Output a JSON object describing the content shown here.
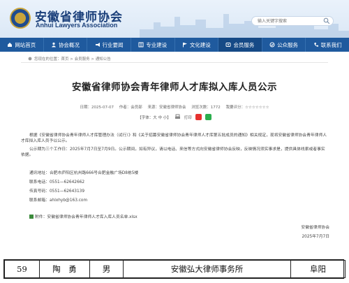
{
  "header": {
    "title": "安徽省律师协会",
    "subtitle": "Anhui Lawyers Association",
    "search_placeholder": "输入关键字搜索"
  },
  "nav": {
    "items": [
      {
        "label": "网站首页",
        "icon": "home-icon"
      },
      {
        "label": "协会概况",
        "icon": "people-icon"
      },
      {
        "label": "行业要闻",
        "icon": "megaphone-icon"
      },
      {
        "label": "专业建设",
        "icon": "book-icon"
      },
      {
        "label": "文化建设",
        "icon": "flag-icon"
      },
      {
        "label": "会员服务",
        "icon": "member-icon"
      },
      {
        "label": "公众服务",
        "icon": "public-icon"
      },
      {
        "label": "联系我们",
        "icon": "phone-icon"
      }
    ],
    "active_index": 5,
    "color": "#1f5a9e"
  },
  "breadcrumb": {
    "text": "您现在的位置：首页 > 会员服务 > 通知公告"
  },
  "article": {
    "title": "安徽省律师协会青年律师人才库拟入库人员公示",
    "meta": {
      "date": "日期：2025-07-07",
      "author": "作者：会员部",
      "source": "来源：安徽省律师协会",
      "views": "浏览次数：1772",
      "rating": "我要评分：☆☆☆☆☆☆☆"
    },
    "tools": {
      "font_size": "【字体：大 中 小】",
      "print": "打印"
    },
    "paragraphs": [
      "根据《安徽省律师协会青年律师人才库管理办法（试行）》和《关于招募安徽省律师协会青年律师人才库第五批成员的通知》相关规定，现将安徽省律师协会青年律师人才库拟入库人员予以公示。",
      "公示期为三个工作日：2025年7月7日至7月9日。公示期间，如有异议，请以电话、来信等方式向安徽省律师协会反映，反映情况须实事求是，提供具体线索或者事实依据。"
    ],
    "contact": {
      "address": "通讯地址：合肥市庐阳区杭州路666号合肥金融广场D8栋5楼",
      "phone": "联系电话：0551—62642662",
      "fax": "传真号码：0551—62643139",
      "email": "联系邮箱：ahlxhyb@163.com"
    },
    "attachment": "附件：安徽省律师协会青年律师人才库入库人员名单.xlsx",
    "signature": {
      "org": "安徽省律师协会",
      "date": "2025年7月7日"
    }
  },
  "table": {
    "row": [
      "59",
      "陶　勇",
      "男",
      "安徽弘大律师事务所",
      "阜阳"
    ]
  }
}
